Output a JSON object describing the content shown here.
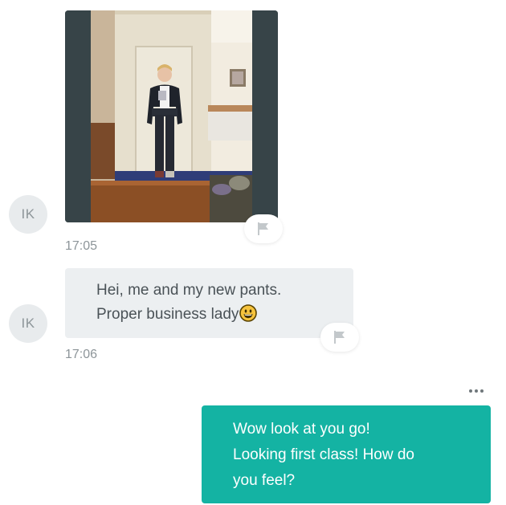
{
  "conversation": {
    "messages": [
      {
        "sender_initials": "IK",
        "type": "photo",
        "icon": "report-flag-icon",
        "time": "17:05"
      },
      {
        "sender_initials": "IK",
        "type": "text",
        "lines": [
          "Hei, me and my new pants.",
          "Proper business lady"
        ],
        "emoji": "grinning-face-emoji",
        "icon": "report-flag-icon",
        "time": "17:06"
      },
      {
        "type": "text",
        "outgoing": true,
        "lines": [
          "Wow look at you go!",
          "Looking first class! How do",
          "you feel?"
        ],
        "options_icon": "more-options-icon"
      }
    ]
  },
  "colors": {
    "outgoing_bubble": "#14b3a3",
    "incoming_bubble": "#eceff1",
    "avatar_bg": "#e8ebed",
    "muted_text": "#8d9599"
  }
}
